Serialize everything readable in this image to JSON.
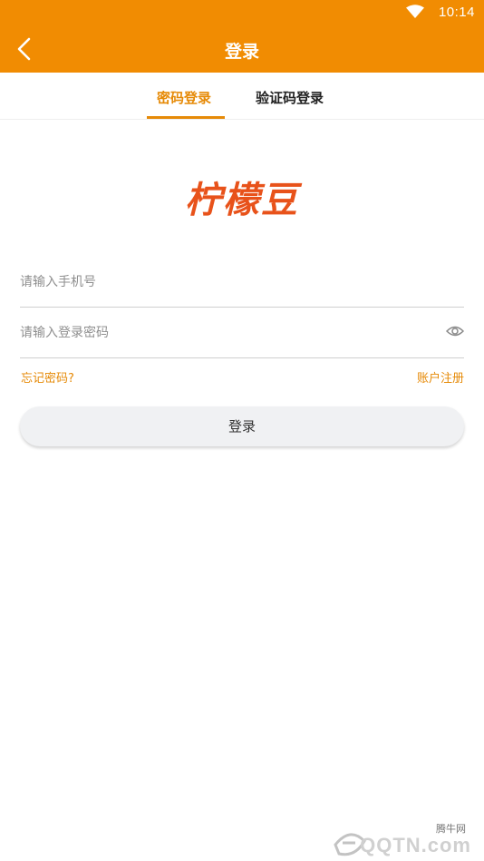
{
  "status_bar": {
    "time": "10:14",
    "wifi_icon": "wifi-icon"
  },
  "app_bar": {
    "title": "登录",
    "back_icon": "chevron-left-icon"
  },
  "tabs": [
    {
      "label": "密码登录",
      "active": true
    },
    {
      "label": "验证码登录",
      "active": false
    }
  ],
  "logo_text": "柠檬豆",
  "form": {
    "phone_placeholder": "请输入手机号",
    "password_placeholder": "请输入登录密码",
    "eye_icon": "eye-icon",
    "forgot_label": "忘记密码?",
    "register_label": "账户注册",
    "login_button": "登录"
  },
  "watermark": {
    "cn": "腾牛网",
    "text": "QQTN.com"
  },
  "colors": {
    "brand": "#f18c02",
    "accent": "#e68a07",
    "logo": "#e8521a"
  }
}
